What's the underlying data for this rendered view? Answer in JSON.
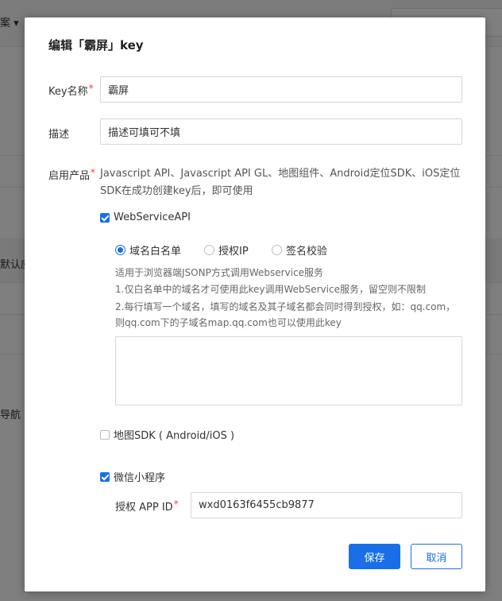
{
  "background": {
    "top_left_text": "案 ▾",
    "row_labels": [
      "默认应",
      "导航"
    ]
  },
  "modal": {
    "title": "编辑「霸屏」key",
    "key_name": {
      "label": "Key名称",
      "required_mark": "*",
      "value": "霸屏"
    },
    "description": {
      "label": "描述",
      "value": "描述可填可不填"
    },
    "products": {
      "label": "启用产品",
      "required_mark": "*",
      "text": "Javascript API、Javascript API GL、地图组件、Android定位SDK、iOS定位SDK在成功创建key后，即可使用"
    },
    "webservice": {
      "label": "WebServiceAPI",
      "checked": true,
      "radios": [
        {
          "label": "域名白名单",
          "selected": true
        },
        {
          "label": "授权IP",
          "selected": false
        },
        {
          "label": "签名校验",
          "selected": false
        }
      ],
      "hints": [
        "适用于浏览器端JSONP方式调用Webservice服务",
        "1.仅白名单中的域名才可使用此key调用WebService服务，留空则不限制",
        "2.每行填写一个域名，填写的域名及其子域名都会同时得到授权，如：qq.com，则qq.com下的子域名map.qq.com也可以使用此key"
      ],
      "textarea_value": ""
    },
    "map_sdk": {
      "label": "地图SDK ( Android/iOS )",
      "checked": false
    },
    "miniprogram": {
      "label": "微信小程序",
      "checked": true,
      "app_id_label": "授权 APP ID",
      "required_mark": "*",
      "app_id_value": "wxd0163f6455cb9877"
    },
    "buttons": {
      "save": "保存",
      "cancel": "取消"
    },
    "colors": {
      "primary": "#1a6fe8",
      "required": "#e54545"
    }
  }
}
